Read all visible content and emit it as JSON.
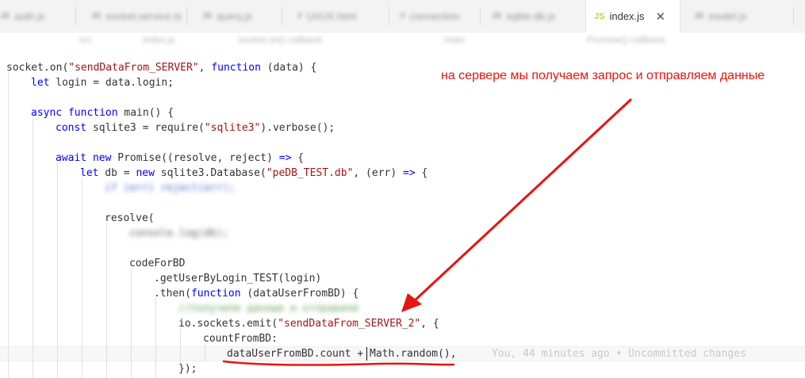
{
  "tabs": [
    {
      "label": "auth.js",
      "icon": "JS",
      "active": false
    },
    {
      "label": "socket.service.ts",
      "icon": "JS",
      "active": false
    },
    {
      "label": "query.js",
      "icon": "JS",
      "active": false
    },
    {
      "label": "UI/UX.html",
      "icon": "#",
      "active": false
    },
    {
      "label": "connection",
      "icon": "#",
      "active": false
    },
    {
      "label": "sqlite-db.js",
      "icon": "JS",
      "active": false
    },
    {
      "label": "index.js",
      "icon": "JS",
      "active": true
    },
    {
      "label": "model.js",
      "icon": "JS",
      "active": false
    }
  ],
  "breadcrumb": [
    "src",
    "index.js",
    "socket.on() callback",
    "main",
    "Promise() callback"
  ],
  "code": {
    "l1a": "socket.on(",
    "l1b": "\"sendDataFrom_SERVER\"",
    "l1c": ", ",
    "l1d": "function",
    "l1e": " (data) {",
    "l2a": "let",
    "l2b": " login = data.login;",
    "l4a": "async function",
    "l4b": " main() {",
    "l5a": "const",
    "l5b": " sqlite3 = require(",
    "l5c": "\"sqlite3\"",
    "l5d": ").verbose();",
    "l7a": "await new",
    "l7b": " Promise((resolve, reject) ",
    "l7c": "=>",
    "l7d": " {",
    "l8a": "let",
    "l8b": " db = ",
    "l8c": "new",
    "l8d": " sqlite3.Database(",
    "l8e": "\"peDB_TEST.db\"",
    "l8f": ", (err) ",
    "l8g": "=>",
    "l8h": " {",
    "l9": "if (err) reject(err);",
    "l11": "resolve(",
    "l12": "console.log(db);",
    "l14": "codeForBD",
    "l15": ".getUserByLogin_TEST(login)",
    "l16a": ".then(",
    "l16b": "function",
    "l16c": " (dataUserFromBD) {",
    "l17": "//получили данные и отправили",
    "l18a": "io.sockets.emit(",
    "l18b": "\"sendDataFrom_SERVER_2\"",
    "l18c": ", {",
    "l19": "countFromBD:",
    "l20": "dataUserFromBD.count + Math.random(),",
    "l21": "});"
  },
  "blame": "You, 44 minutes ago • Uncommitted changes",
  "annotation": "на сервере мы получаем запрос и отправляем данные",
  "colors": {
    "annotation": "#e8140f",
    "keyword": "#0000ff",
    "string": "#a31515"
  }
}
